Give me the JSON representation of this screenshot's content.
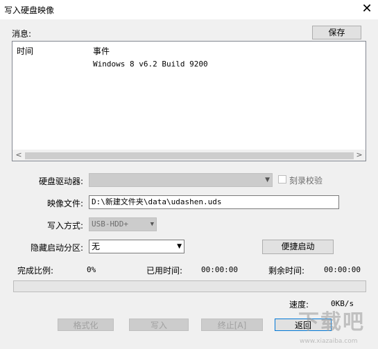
{
  "window": {
    "title": "写入硬盘映像",
    "close_glyph": "✕"
  },
  "messages": {
    "label": "消息:",
    "save_button": "保存",
    "columns": [
      "时间",
      "事件"
    ],
    "rows": [
      {
        "time": "",
        "event": "Windows 8 v6.2 Build 9200"
      }
    ],
    "scroll_left": "<",
    "scroll_right": ">"
  },
  "form": {
    "drive_label": "硬盘驱动器:",
    "drive_value": "",
    "verify_label": "刻录校验",
    "image_label": "映像文件:",
    "image_value": "D:\\新建文件夹\\data\\udashen.uds",
    "write_mode_label": "写入方式:",
    "write_mode_value": "USB-HDD+",
    "hidden_partition_label": "隐藏启动分区:",
    "hidden_partition_value": "无",
    "quick_boot_button": "便捷启动"
  },
  "status": {
    "ratio_label": "完成比例:",
    "ratio_value": "0%",
    "elapsed_label": "已用时间:",
    "elapsed_value": "00:00:00",
    "remaining_label": "剩余时间:",
    "remaining_value": "00:00:00",
    "progress": 0,
    "speed_label": "速度:",
    "speed_value": "0KB/s"
  },
  "buttons": {
    "format": "格式化",
    "write": "写入",
    "stop": "终止[A]",
    "back": "返回"
  },
  "watermark": {
    "brand": "下载吧",
    "url": "www.xiazaiba.com"
  },
  "icons": {
    "close": "close-icon",
    "dropdown": "chevron-down-icon"
  }
}
